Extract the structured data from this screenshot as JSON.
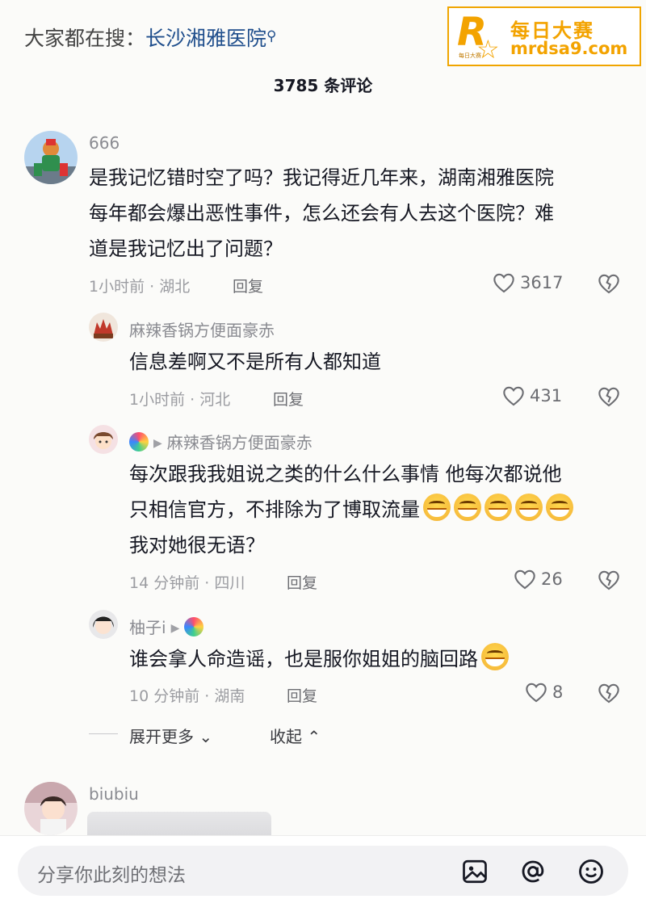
{
  "search_hint": {
    "prefix": "大家都在搜：",
    "query": "长沙湘雅医院",
    "search_icon": "search-icon"
  },
  "watermark": {
    "logo_letter": "R",
    "logo_small": "每日大赛",
    "title": "每日大赛",
    "url": "mrdsa9.com",
    "accent_color": "#f3a300"
  },
  "comment_count": "3785 条评论",
  "comments": [
    {
      "username": "666",
      "lines": [
        "是我记忆错时空了吗？我记得近几年来，湖南湘雅医院",
        "每年都会爆出恶性事件，怎么还会有人去这个医院？难",
        "道是我记忆出了问题？"
      ],
      "time_location": "1小时前 · 湖北",
      "reply_label": "回复",
      "likes": "3617"
    },
    {
      "username": "麻辣香锅方便面豪赤",
      "lines": [
        "信息差啊又不是所有人都知道"
      ],
      "time_location": "1小时前 · 河北",
      "reply_label": "回复",
      "likes": "431"
    },
    {
      "reply_to": "麻辣香锅方便面豪赤",
      "lines": [
        "每次跟我我姐说之类的什么什么事情 他每次都说他",
        "只相信官方，不排除为了博取流量",
        "我对她很无语？"
      ],
      "time_location": "14 分钟前 · 四川",
      "reply_label": "回复",
      "likes": "26"
    },
    {
      "username": "柚子i",
      "lines": [
        "谁会拿人命造谣，也是服你姐姐的脑回路"
      ],
      "time_location": "10 分钟前 · 湖南",
      "reply_label": "回复",
      "likes": "8"
    }
  ],
  "expand_more": "展开更多",
  "collapse": "收起",
  "next_comment": {
    "username": "biubiu"
  },
  "input": {
    "placeholder": "分享你此刻的想法",
    "icons": [
      "image-icon",
      "at-icon",
      "emoji-icon"
    ]
  }
}
